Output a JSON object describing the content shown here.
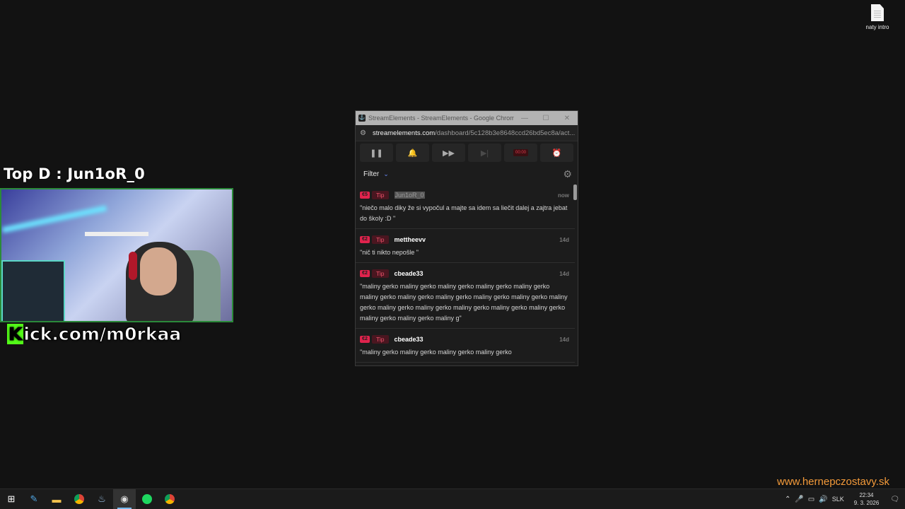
{
  "desktop": {
    "icons": [
      {
        "label": "naty intro",
        "icon": "document-icon"
      }
    ]
  },
  "overlay": {
    "top_donor": "Top D : Jun1oR_0",
    "kick_prefix": "K",
    "kick_rest": "ick.com/m0rkaa",
    "watermark": "www.hernepczostavy.sk"
  },
  "popup": {
    "title": "StreamElements - StreamElements - Google Chrome",
    "url_host": "streamelements.com",
    "url_path": "/dashboard/5c128b3e8648ccd26bd5ec8a/act...",
    "controls": [
      {
        "name": "pause-button",
        "icon": "❚❚",
        "enabled": true
      },
      {
        "name": "mute-alerts-button",
        "icon": "🔔",
        "enabled": true
      },
      {
        "name": "skip-button",
        "icon": "▶▶",
        "enabled": true
      },
      {
        "name": "next-button",
        "icon": "▶|",
        "enabled": false
      },
      {
        "name": "timer-button",
        "icon": "00:00",
        "enabled": true
      },
      {
        "name": "alarm-button",
        "icon": "⏰",
        "enabled": false
      }
    ],
    "filter_label": "Filter",
    "feed": [
      {
        "amount": "€5",
        "type": "Tip",
        "user": "Jun1oR_0",
        "highlight": true,
        "age": "now",
        "message": "\"niečo malo diky že si vypočul a majte sa idem sa liečit dalej a zajtra jebat do školy :D \""
      },
      {
        "amount": "€2",
        "type": "Tip",
        "user": "mettheevv",
        "highlight": false,
        "age": "14d",
        "message": "\"nič ti nikto nepošle \""
      },
      {
        "amount": "€2",
        "type": "Tip",
        "user": "cbeade33",
        "highlight": false,
        "age": "14d",
        "message": "\"maliny gerko maliny gerko maliny gerko maliny gerko maliny gerko maliny gerko maliny gerko maliny gerko maliny gerko maliny gerko maliny gerko maliny gerko maliny gerko maliny gerko maliny gerko maliny gerko maliny gerko maliny gerko maliny g\""
      },
      {
        "amount": "€2",
        "type": "Tip",
        "user": "cbeade33",
        "highlight": false,
        "age": "14d",
        "message": "\"maliny gerko maliny gerko maliny gerko maliny gerko"
      }
    ]
  },
  "taskbar": {
    "apps": [
      {
        "name": "start-button",
        "icon": "⊞",
        "active": false
      },
      {
        "name": "taskbar-app-1",
        "icon": "✎",
        "active": false
      },
      {
        "name": "taskbar-file-explorer",
        "icon": "▬",
        "active": false
      },
      {
        "name": "taskbar-chrome-profile",
        "icon": "●",
        "active": false
      },
      {
        "name": "taskbar-steam",
        "icon": "♨",
        "active": false
      },
      {
        "name": "taskbar-obs",
        "icon": "◉",
        "active": true
      },
      {
        "name": "taskbar-spotify",
        "icon": "●",
        "active": false
      },
      {
        "name": "taskbar-chrome",
        "icon": "●",
        "active": false
      }
    ],
    "language": "SLK",
    "time": "22:34",
    "date": "9. 3. 2026"
  }
}
